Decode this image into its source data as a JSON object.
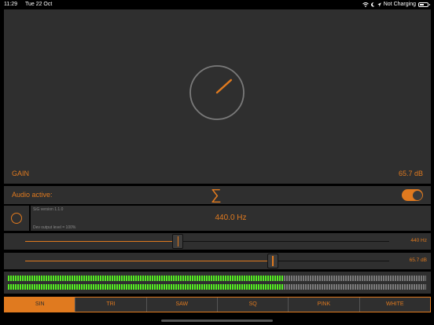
{
  "status": {
    "time": "11:29",
    "date": "Tue 22 Oct",
    "charging": "Not Charging",
    "battery_level": 0.6
  },
  "main": {
    "gain_label": "GAIN",
    "gain_value": "65.7 dB"
  },
  "audio": {
    "label": "Audio active:",
    "sigma": "∑",
    "enabled": true
  },
  "info": {
    "version": "SiG version 1.1.0",
    "frequency": "440.0 Hz",
    "dev_output": "Dev output level = 100%"
  },
  "sliders": {
    "frequency": {
      "value_label": "440 Hz",
      "position": 0.42
    },
    "gain": {
      "value_label": "65.7 dB",
      "position": 0.68
    }
  },
  "meters": {
    "left_level": 0.66,
    "right_level": 0.66
  },
  "waveforms": {
    "items": [
      "SIN",
      "TRI",
      "SAW",
      "SQ",
      "PINK",
      "WHITE"
    ],
    "selected": "SIN"
  },
  "colors": {
    "accent": "#e07a1f",
    "panel": "#2f2f2f",
    "meter_on": "#55ee22",
    "meter_off": "#7a7a7a"
  },
  "icons": [
    "wifi-icon",
    "moon-icon",
    "location-icon",
    "battery-icon",
    "record-icon",
    "sigma-icon"
  ]
}
